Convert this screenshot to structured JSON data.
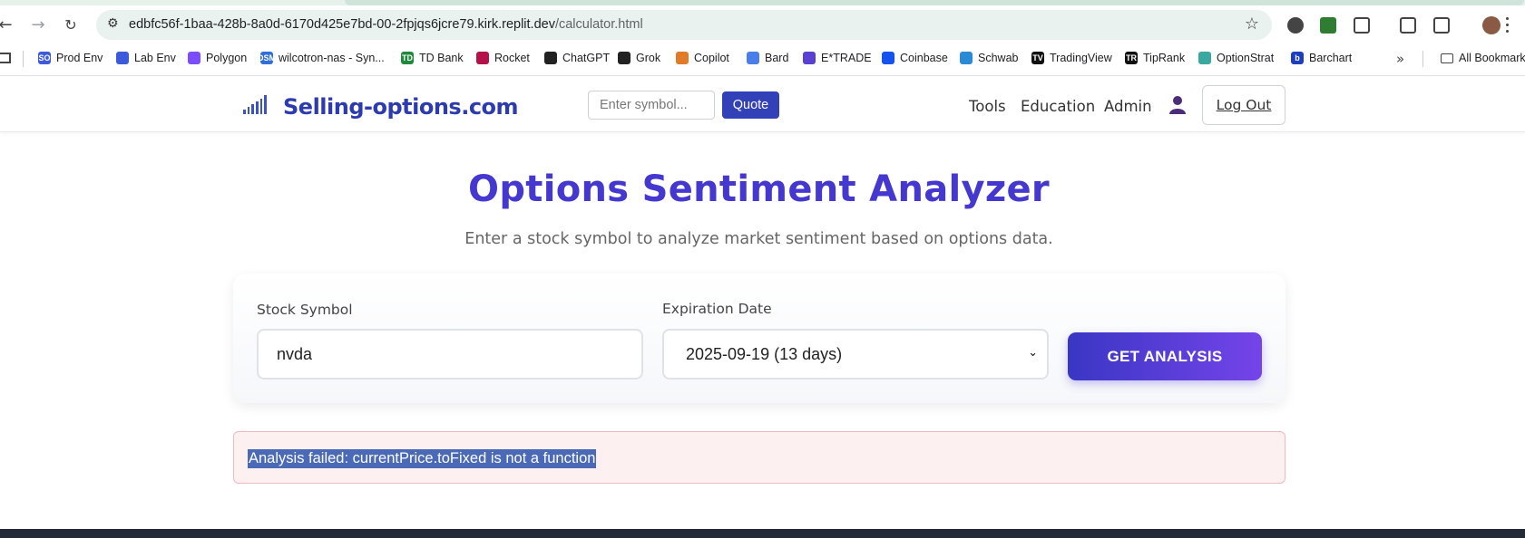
{
  "browser": {
    "url_host": "edbfc56f-1baa-428b-8a0d-6170d425e7bd-00-2fpjqs6jcre79.kirk.replit.dev",
    "url_path": "/calculator.html",
    "bookmarks": [
      {
        "label": "Prod Env",
        "icon": "SO",
        "color": "#3b5bdb"
      },
      {
        "label": "Lab Env",
        "icon": "",
        "color": "#3b5bdb"
      },
      {
        "label": "Polygon",
        "icon": "",
        "color": "#7c4dff"
      },
      {
        "label": "wilcotron-nas - Syn...",
        "icon": "DSM",
        "color": "#2f6fdc"
      },
      {
        "label": "TD Bank",
        "icon": "TD",
        "color": "#1f8a3b"
      },
      {
        "label": "Rocket",
        "icon": "",
        "color": "#b3124a"
      },
      {
        "label": "ChatGPT",
        "icon": "",
        "color": "#222222"
      },
      {
        "label": "Grok",
        "icon": "",
        "color": "#222222"
      },
      {
        "label": "Copilot",
        "icon": "",
        "color": "#e07b2a"
      },
      {
        "label": "Bard",
        "icon": "",
        "color": "#4a7ee8"
      },
      {
        "label": "E*TRADE",
        "icon": "",
        "color": "#5b3fd1"
      },
      {
        "label": "Coinbase",
        "icon": "",
        "color": "#1652f0"
      },
      {
        "label": "Schwab",
        "icon": "",
        "color": "#2a8ad4"
      },
      {
        "label": "TradingView",
        "icon": "TV",
        "color": "#111111"
      },
      {
        "label": "TipRank",
        "icon": "TR",
        "color": "#111111"
      },
      {
        "label": "OptionStrat",
        "icon": "",
        "color": "#3aa7a0"
      },
      {
        "label": "Barchart",
        "icon": "b",
        "color": "#1d3fbf"
      }
    ],
    "all_bookmarks": "All Bookmarks"
  },
  "header": {
    "logo_text": "Selling-options.com",
    "symbol_placeholder": "Enter symbol...",
    "quote_label": "Quote",
    "nav": [
      "Tools",
      "Education",
      "Admin"
    ],
    "logout_label": "Log Out"
  },
  "main": {
    "title": "Options Sentiment Analyzer",
    "subtitle": "Enter a stock symbol to analyze market sentiment based on options data.",
    "symbol_label": "Stock Symbol",
    "symbol_value": "nvda",
    "expiration_label": "Expiration Date",
    "expiration_value": "2025-09-19 (13 days)",
    "analyze_label": "GET ANALYSIS",
    "error_text": "Analysis failed: currentPrice.toFixed is not a function"
  },
  "colors": {
    "brand": "#2d3bb1",
    "accent_gradient_start": "#3a36c4",
    "accent_gradient_end": "#7544e9",
    "error_bg": "#fdf0f0"
  }
}
